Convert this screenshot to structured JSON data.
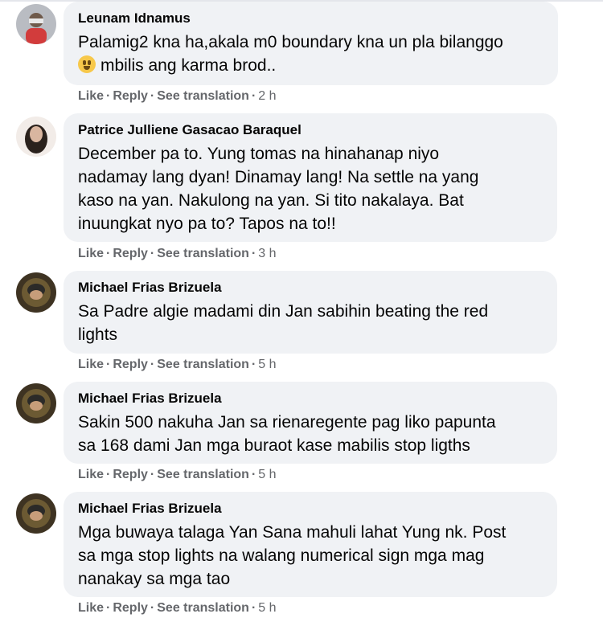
{
  "comments": [
    {
      "author": "Leunam Idnamus",
      "lines": [
        "Palamig2 kna ha,akala m0 boundary kna un pla bilanggo",
        "mbilis ang karma brod.."
      ],
      "actions": {
        "like": "Like",
        "reply": "Reply",
        "translate": "See translation",
        "time": "2 h"
      },
      "avatar_color": "#8a8f98"
    },
    {
      "author": "Patrice Julliene Gasacao Baraquel",
      "lines": [
        "December pa to. Yung tomas na hinahanap niyo",
        "nadamay lang dyan! Dinamay lang! Na settle na yang",
        "kaso na yan. Nakulong na yan. Si tito nakalaya. Bat",
        "inuungkat nyo pa to? Tapos na to!!"
      ],
      "actions": {
        "like": "Like",
        "reply": "Reply",
        "translate": "See translation",
        "time": "3 h"
      },
      "avatar_color": "#c9b7ad"
    },
    {
      "author": "Michael Frias Brizuela",
      "lines": [
        "Sa Padre algie madami din Jan sabihin beating the red",
        "lights"
      ],
      "actions": {
        "like": "Like",
        "reply": "Reply",
        "translate": "See translation",
        "time": "5 h"
      },
      "avatar_color": "#5a4a2c"
    },
    {
      "author": "Michael Frias Brizuela",
      "lines": [
        "Sakin 500 nakuha Jan sa rienaregente pag liko papunta",
        "sa 168 dami Jan mga buraot kase mabilis stop ligths"
      ],
      "actions": {
        "like": "Like",
        "reply": "Reply",
        "translate": "See translation",
        "time": "5 h"
      },
      "avatar_color": "#5a4a2c"
    },
    {
      "author": "Michael Frias Brizuela",
      "lines": [
        "Mga buwaya talaga Yan Sana mahuli lahat Yung nk. Post",
        "sa mga stop lights na walang numerical sign mga mag",
        "nanakay sa mga tao"
      ],
      "actions": {
        "like": "Like",
        "reply": "Reply",
        "translate": "See translation",
        "time": "5 h"
      },
      "avatar_color": "#5a4a2c"
    }
  ]
}
